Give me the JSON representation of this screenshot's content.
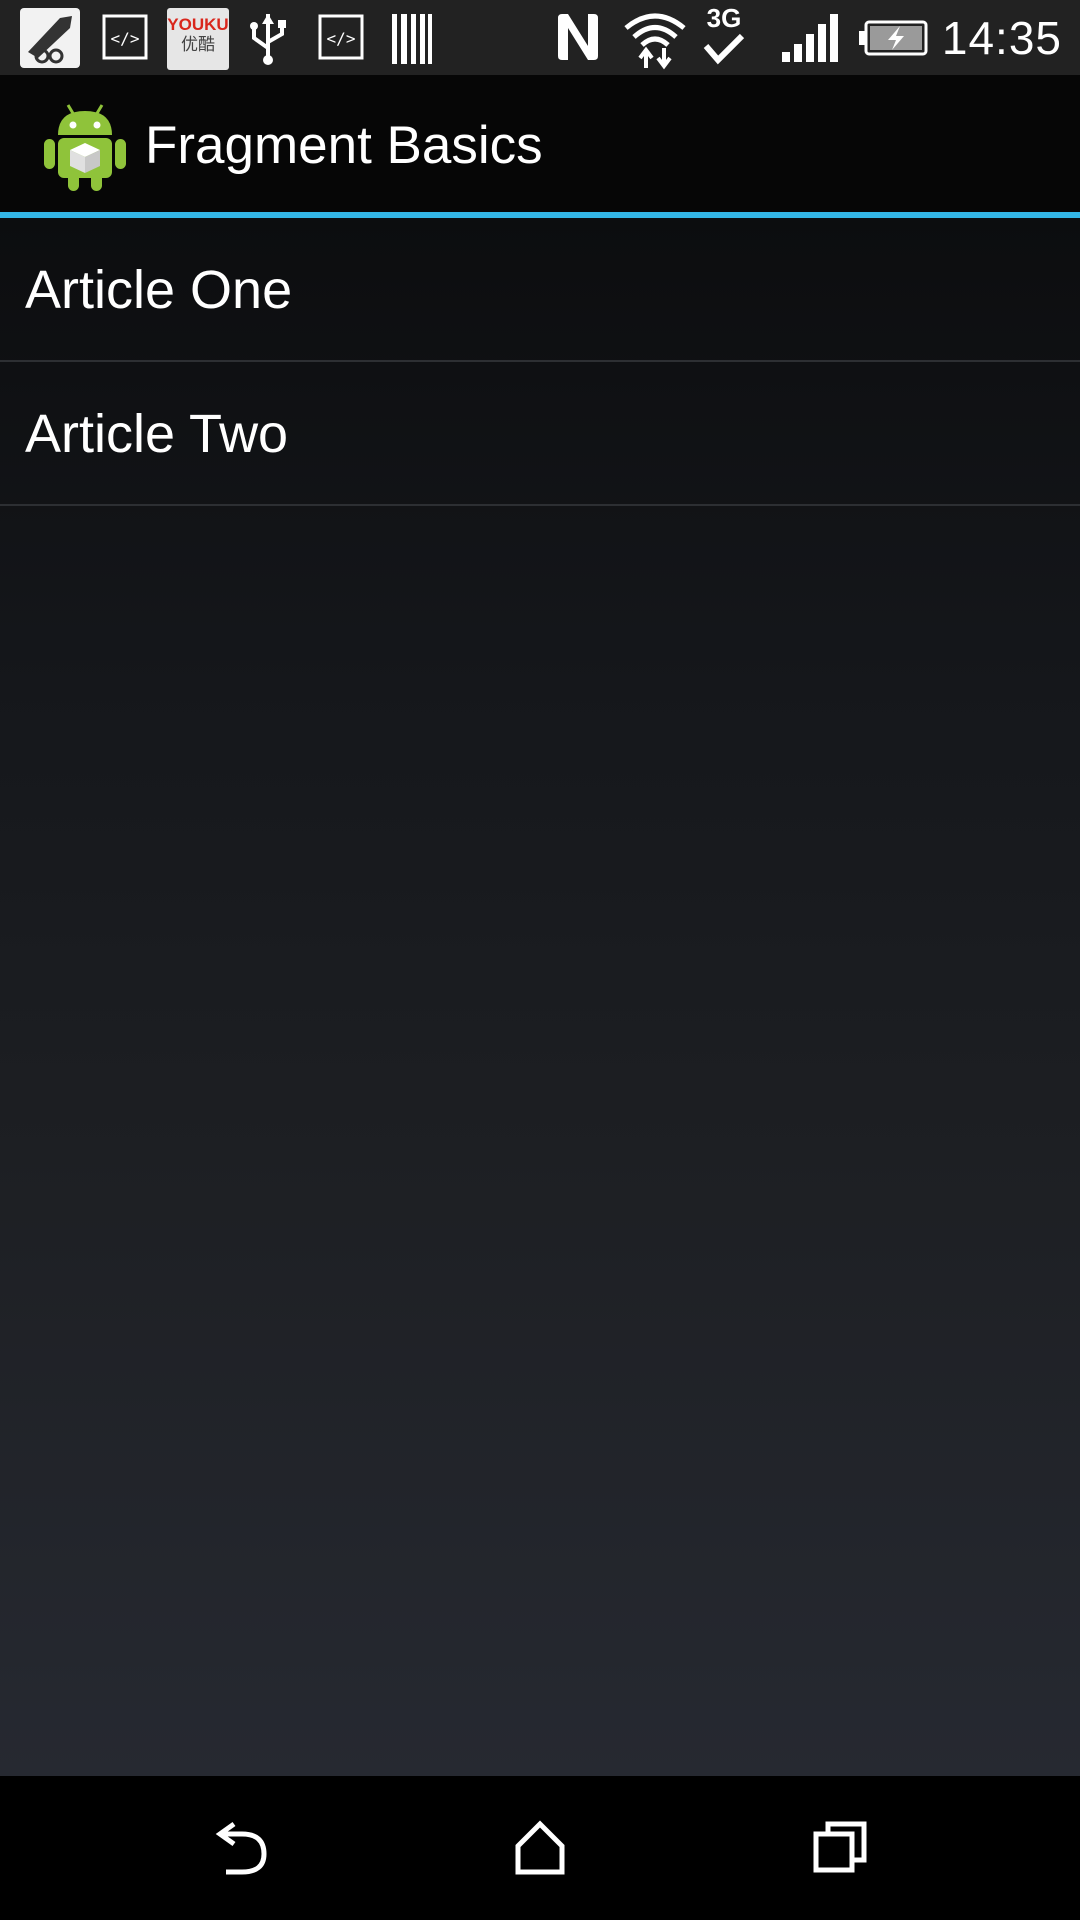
{
  "status_bar": {
    "time": "14:35",
    "left_icons": [
      "signature-app-icon",
      "code-icon",
      "youku-icon",
      "usb-icon",
      "code-icon",
      "barcode-icon"
    ],
    "youku_label_top": "YOUKU",
    "youku_label_bottom": "优酷",
    "network_label": "3G",
    "right_icons": [
      "nfc-icon",
      "wifi-icon",
      "network-3g-icon",
      "signal-icon",
      "battery-charging-icon"
    ]
  },
  "action_bar": {
    "title": "Fragment Basics",
    "accent_color": "#33b5e5"
  },
  "list": {
    "items": [
      {
        "label": "Article One"
      },
      {
        "label": "Article Two"
      }
    ]
  },
  "nav_bar": {
    "buttons": [
      "back-icon",
      "home-icon",
      "recent-apps-icon"
    ]
  }
}
